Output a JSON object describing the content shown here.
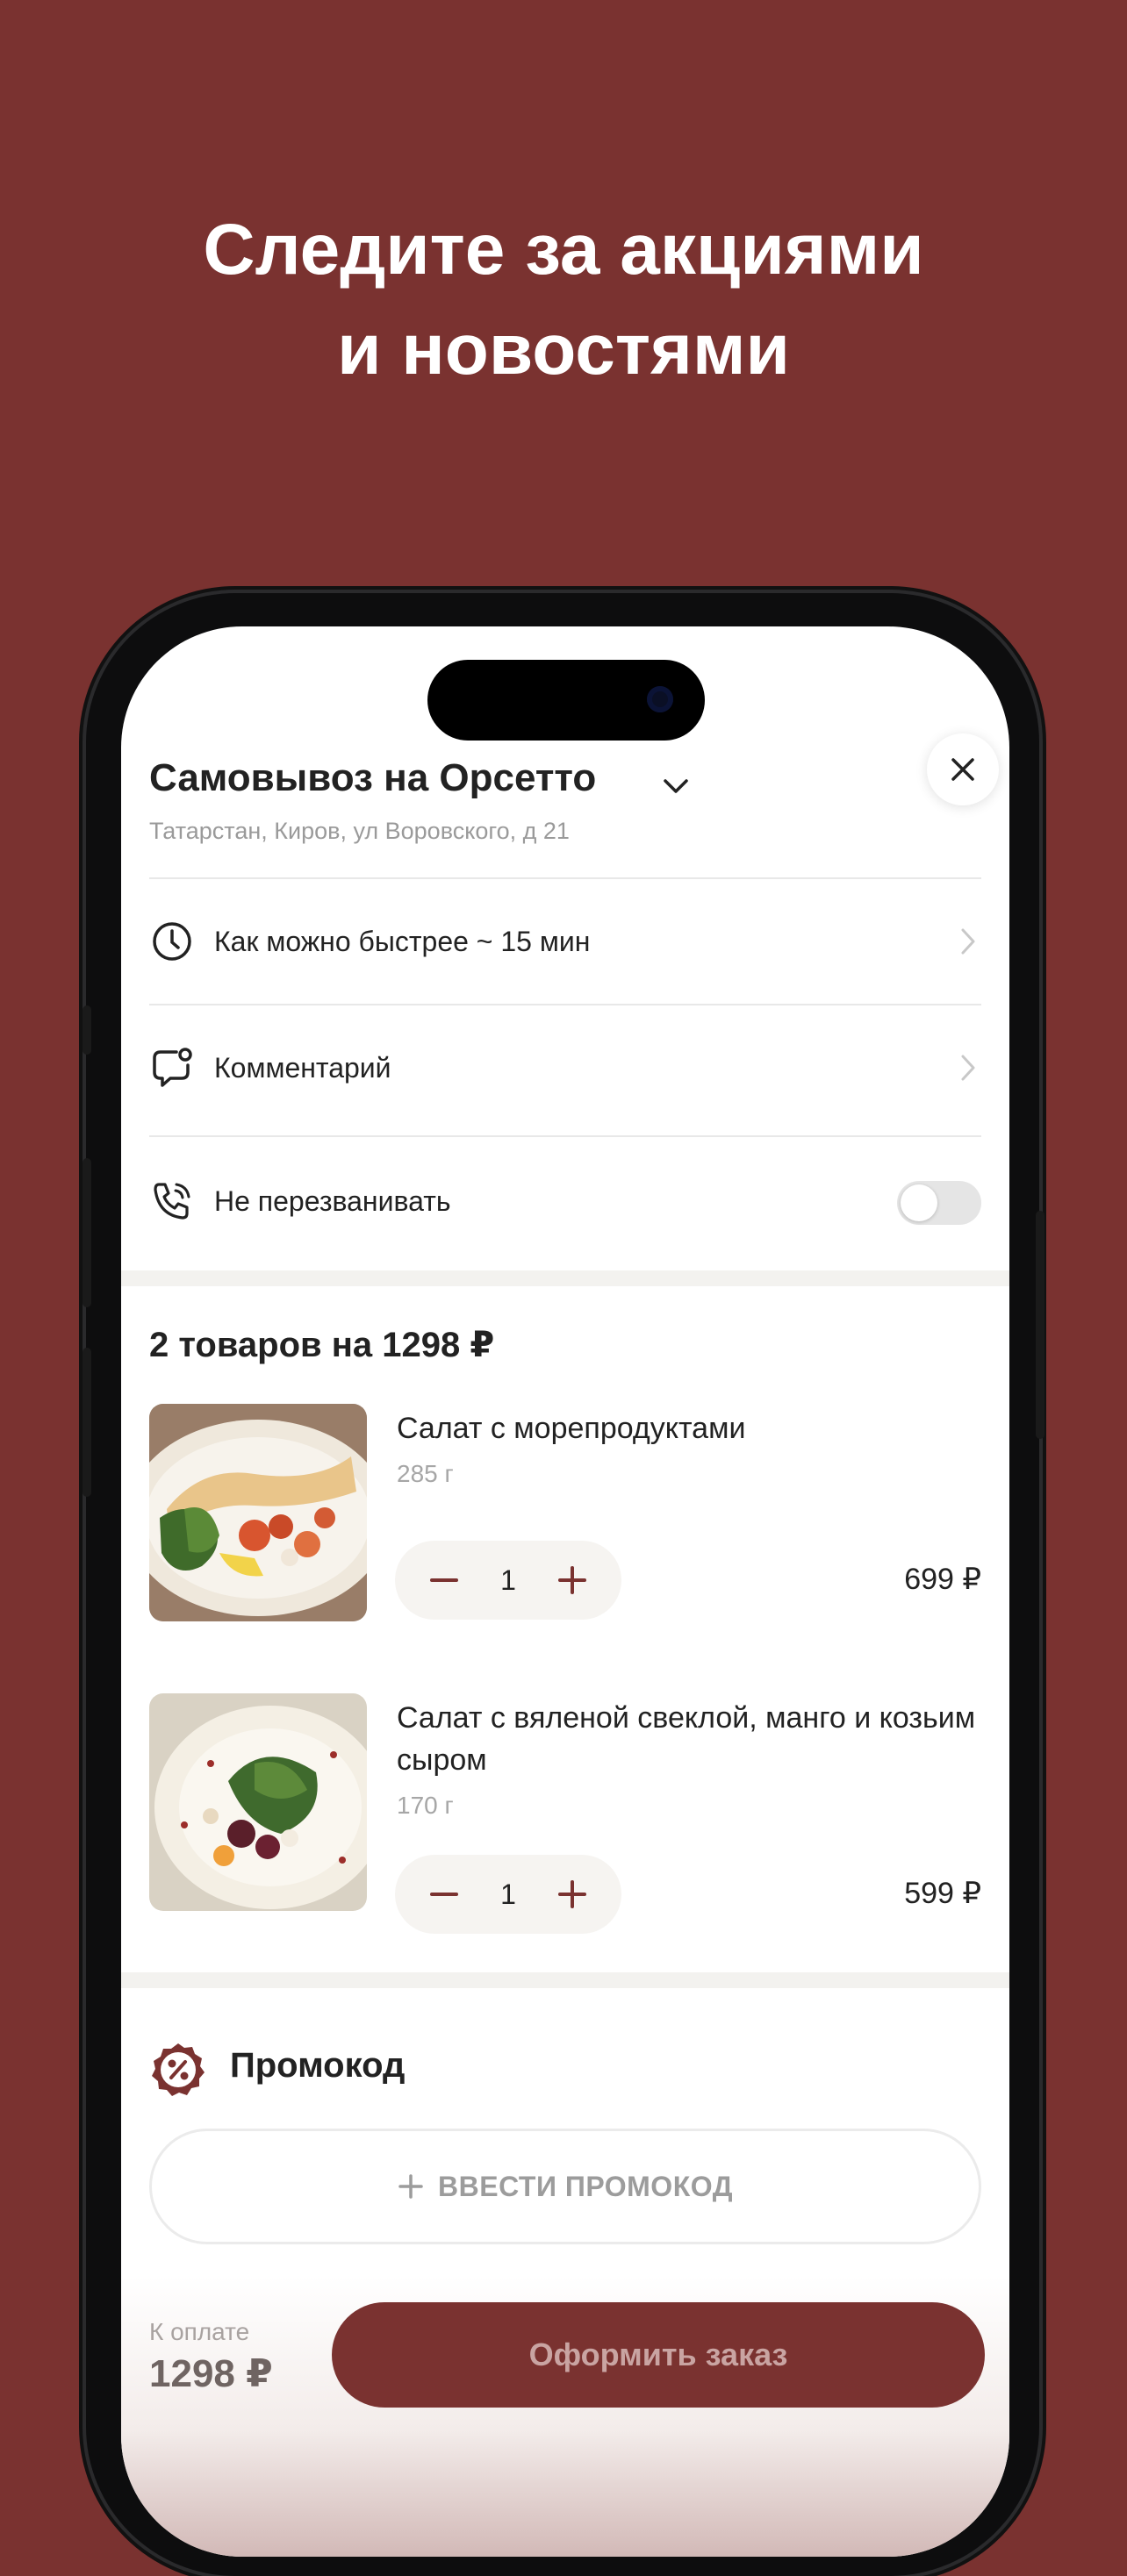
{
  "headline": {
    "line1": "Следите за акциями",
    "line2": "и новостями"
  },
  "colors": {
    "background": "#7a3230",
    "accent": "#7a3230"
  },
  "header": {
    "title": "Самовывоз на Орсетто",
    "address": "Татарстан, Киров, ул Воровского, д 21",
    "close_icon": "close-icon",
    "dropdown_icon": "chevron-down-icon"
  },
  "options": {
    "time": {
      "label": "Как можно быстрее  ~ 15 мин",
      "icon": "clock-icon"
    },
    "comment": {
      "label": "Комментарий",
      "icon": "chat-bubble-icon"
    },
    "no_call": {
      "label": "Не перезванивать",
      "icon": "phone-icon",
      "toggle_on": false
    }
  },
  "cart": {
    "title": "2 товаров на 1298 ₽",
    "items": [
      {
        "name": "Салат с морепродуктами",
        "weight": "285 г",
        "qty": "1",
        "price": "699 ₽"
      },
      {
        "name": "Салат с вяленой свеклой, манго и козьим сыром",
        "weight": "170 г",
        "qty": "1",
        "price": "599 ₽"
      }
    ]
  },
  "promo": {
    "title": "Промокод",
    "button_label": "ВВЕСТИ ПРОМОКОД",
    "icon": "percent-badge-icon"
  },
  "footer": {
    "pay_label": "К оплате",
    "pay_amount": "1298 ₽",
    "order_button": "Оформить заказ"
  }
}
